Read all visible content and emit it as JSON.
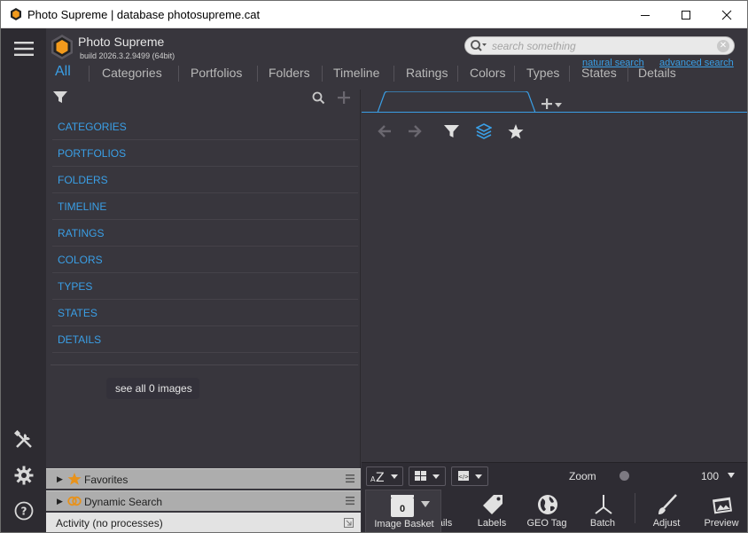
{
  "window": {
    "title": "Photo Supreme | database photosupreme.cat",
    "minimize_icon": "minimize-icon",
    "maximize_icon": "maximize-icon",
    "close_icon": "close-icon"
  },
  "brand": {
    "name": "Photo Supreme",
    "build": "build 2026.3.2.9499 (64bit)"
  },
  "search": {
    "placeholder": "search something",
    "natural_link": "natural search",
    "advanced_link": "advanced search"
  },
  "tabs": [
    {
      "label": "All",
      "active": true
    },
    {
      "label": "Categories"
    },
    {
      "label": "Portfolios"
    },
    {
      "label": "Folders"
    },
    {
      "label": "Timeline"
    },
    {
      "label": "Ratings"
    },
    {
      "label": "Colors"
    },
    {
      "label": "Types"
    },
    {
      "label": "States"
    },
    {
      "label": "Details"
    }
  ],
  "categories": [
    "CATEGORIES",
    "PORTFOLIOS",
    "FOLDERS",
    "TIMELINE",
    "RATINGS",
    "COLORS",
    "TYPES",
    "STATES",
    "DETAILS"
  ],
  "see_all": "see all 0 images",
  "strips": {
    "favorites": "Favorites",
    "dynamic_search": "Dynamic Search",
    "activity": "Activity (no processes)"
  },
  "zoom": {
    "label": "Zoom",
    "value": "100"
  },
  "basket": {
    "count": "0",
    "label": "Image Basket"
  },
  "tools": [
    {
      "label": "ails"
    },
    {
      "label": "Labels"
    },
    {
      "label": "GEO Tag"
    },
    {
      "label": "Batch"
    },
    {
      "label": "Adjust"
    },
    {
      "label": "Preview"
    }
  ],
  "colors": {
    "accent": "#3a9fe6",
    "background": "#38363d",
    "sidebar": "#2d2b31",
    "logo_orange": "#f29a1c"
  }
}
